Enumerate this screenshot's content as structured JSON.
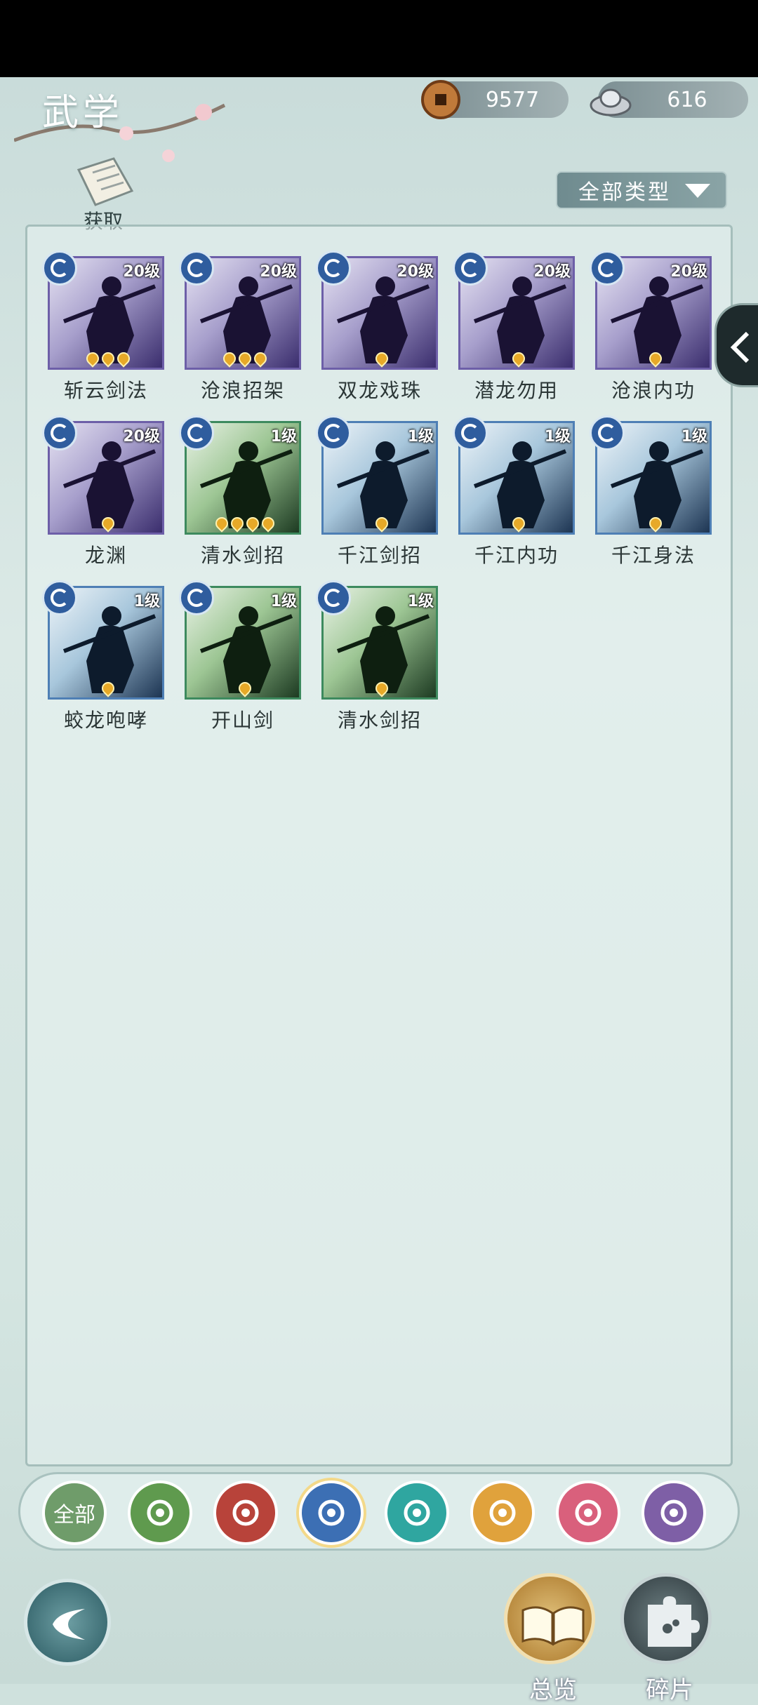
{
  "header": {
    "title": "武学"
  },
  "currency": {
    "copper": "9577",
    "silver": "616"
  },
  "acquire": {
    "label": "获取"
  },
  "filter": {
    "label": "全部类型"
  },
  "skills": [
    {
      "name": "斩云剑法",
      "level": "20级",
      "stars": 3,
      "color": "purple"
    },
    {
      "name": "沧浪招架",
      "level": "20级",
      "stars": 3,
      "color": "purple"
    },
    {
      "name": "双龙戏珠",
      "level": "20级",
      "stars": 1,
      "color": "purple"
    },
    {
      "name": "潜龙勿用",
      "level": "20级",
      "stars": 1,
      "color": "purple"
    },
    {
      "name": "沧浪内功",
      "level": "20级",
      "stars": 1,
      "color": "purple"
    },
    {
      "name": "龙渊",
      "level": "20级",
      "stars": 1,
      "color": "purple"
    },
    {
      "name": "清水剑招",
      "level": "1级",
      "stars": 4,
      "color": "green"
    },
    {
      "name": "千江剑招",
      "level": "1级",
      "stars": 1,
      "color": "blue"
    },
    {
      "name": "千江内功",
      "level": "1级",
      "stars": 1,
      "color": "blue"
    },
    {
      "name": "千江身法",
      "level": "1级",
      "stars": 1,
      "color": "blue"
    },
    {
      "name": "蛟龙咆哮",
      "level": "1级",
      "stars": 1,
      "color": "blue"
    },
    {
      "name": "开山剑",
      "level": "1级",
      "stars": 1,
      "color": "green"
    },
    {
      "name": "清水剑招",
      "level": "1级",
      "stars": 1,
      "color": "green"
    }
  ],
  "categories": [
    {
      "name": "all",
      "label": "全部",
      "color": "#6f9c6a"
    },
    {
      "name": "sword",
      "label": "",
      "color": "#5f9a4e"
    },
    {
      "name": "fire",
      "label": "",
      "color": "#b8433a"
    },
    {
      "name": "wave",
      "label": "",
      "color": "#3c6fb4",
      "active": true
    },
    {
      "name": "butterfly",
      "label": "",
      "color": "#2fa6a0"
    },
    {
      "name": "shield",
      "label": "",
      "color": "#e0a23c"
    },
    {
      "name": "moon",
      "label": "",
      "color": "#d9607c"
    },
    {
      "name": "rose",
      "label": "",
      "color": "#7e5fa6"
    }
  ],
  "bottom": {
    "overview": "总览",
    "fragments": "碎片"
  }
}
